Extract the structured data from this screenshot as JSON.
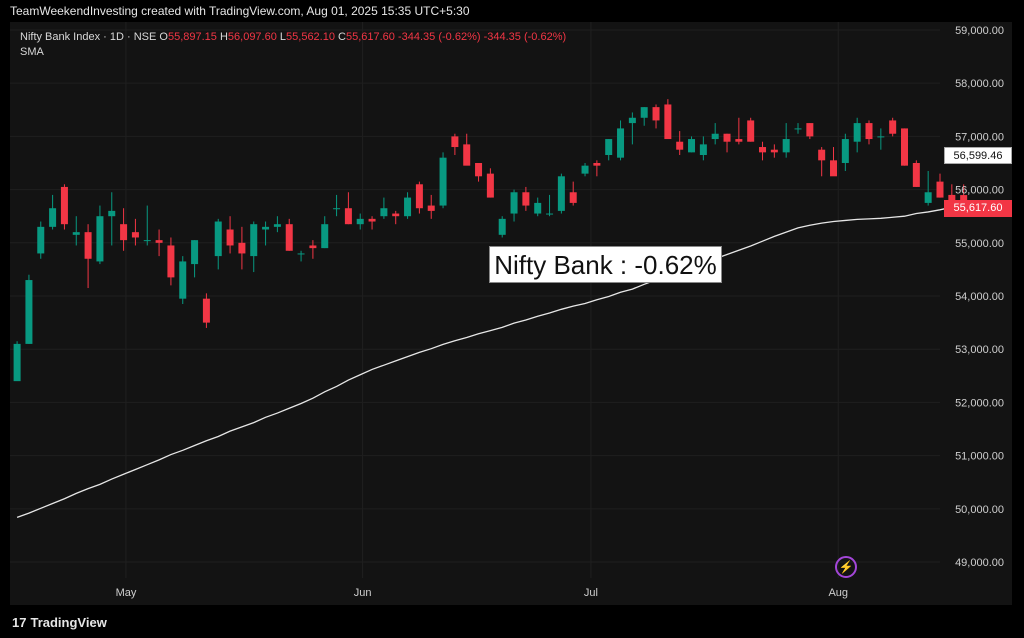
{
  "header": {
    "attribution": "TeamWeekendInvesting created with TradingView.com, Aug 01, 2025 15:35 UTC+5:30"
  },
  "legend": {
    "symbol": "Nifty Bank Index · 1D · NSE",
    "open_label": "O",
    "open": "55,897.15",
    "high_label": "H",
    "high": "56,097.60",
    "low_label": "L",
    "low": "55,562.10",
    "close_label": "C",
    "close": "55,617.60",
    "change": "-344.35 (-0.62%)",
    "change2": "-344.35 (-0.62%)",
    "indicator": "SMA"
  },
  "annotation": "Nifty Bank : -0.62%",
  "price_tags": {
    "sma": "56,599.46",
    "last": "55,617.60"
  },
  "footer": {
    "brand": "TradingView",
    "logo": "17"
  },
  "colors": {
    "up": "#089981",
    "down": "#f23645",
    "sma": "#e6e6e6",
    "bg": "#131313"
  },
  "icons": {
    "bolt": "lightning-icon"
  },
  "chart_data": {
    "type": "candlestick",
    "ylim": [
      48700,
      59150
    ],
    "y_ticks": [
      "49,000.00",
      "50,000.00",
      "51,000.00",
      "52,000.00",
      "53,000.00",
      "54,000.00",
      "55,000.00",
      "56,000.00",
      "57,000.00",
      "58,000.00",
      "59,000.00"
    ],
    "y_tick_values": [
      49000,
      50000,
      51000,
      52000,
      53000,
      54000,
      55000,
      56000,
      57000,
      58000,
      59000
    ],
    "x_labels": [
      {
        "label": "May",
        "index": 9.2
      },
      {
        "label": "Jun",
        "index": 29.2
      },
      {
        "label": "Jul",
        "index": 48.5
      },
      {
        "label": "Aug",
        "index": 69.4
      }
    ],
    "index_range": [
      -0.6,
      78
    ],
    "candles": [
      [
        52400,
        53150,
        52450,
        53100
      ],
      [
        53100,
        54400,
        53100,
        54300
      ],
      [
        54800,
        55400,
        54700,
        55300
      ],
      [
        55300,
        55900,
        55250,
        55650
      ],
      [
        56050,
        56100,
        55250,
        55350
      ],
      [
        55150,
        55500,
        54950,
        55200
      ],
      [
        55200,
        55350,
        54150,
        54700
      ],
      [
        54650,
        55700,
        54600,
        55500
      ],
      [
        55500,
        55950,
        54950,
        55600
      ],
      [
        55350,
        55650,
        54850,
        55050
      ],
      [
        55200,
        55450,
        54950,
        55100
      ],
      [
        55050,
        55700,
        54950,
        55050
      ],
      [
        55050,
        55250,
        54750,
        55000
      ],
      [
        54950,
        55100,
        54200,
        54350
      ],
      [
        53950,
        54750,
        53850,
        54650
      ],
      [
        54600,
        55050,
        54350,
        55050
      ],
      [
        53950,
        54050,
        53400,
        53500
      ],
      [
        54750,
        55450,
        54500,
        55400
      ],
      [
        55250,
        55500,
        54800,
        54950
      ],
      [
        55000,
        55300,
        54500,
        54800
      ],
      [
        54750,
        55400,
        54450,
        55350
      ],
      [
        55250,
        55400,
        54950,
        55300
      ],
      [
        55300,
        55500,
        55200,
        55350
      ],
      [
        55350,
        55450,
        54850,
        54850
      ],
      [
        54800,
        54850,
        54650,
        54800
      ],
      [
        54950,
        55050,
        54700,
        54900
      ],
      [
        54900,
        55500,
        54900,
        55350
      ],
      [
        55650,
        55900,
        55500,
        55650
      ],
      [
        55650,
        55950,
        55350,
        55350
      ],
      [
        55350,
        55550,
        55250,
        55450
      ],
      [
        55450,
        55500,
        55250,
        55400
      ],
      [
        55500,
        55850,
        55450,
        55650
      ],
      [
        55550,
        55600,
        55350,
        55500
      ],
      [
        55500,
        55950,
        55450,
        55850
      ],
      [
        56100,
        56150,
        55550,
        55650
      ],
      [
        55700,
        55900,
        55450,
        55600
      ],
      [
        55700,
        56700,
        55650,
        56600
      ],
      [
        57000,
        57050,
        56650,
        56800
      ],
      [
        56850,
        57050,
        56500,
        56450
      ],
      [
        56500,
        56450,
        56150,
        56250
      ],
      [
        56300,
        56400,
        55850,
        55850
      ],
      [
        55150,
        55500,
        55100,
        55450
      ],
      [
        55550,
        56000,
        55400,
        55950
      ],
      [
        55950,
        56050,
        55600,
        55700
      ],
      [
        55550,
        55850,
        55500,
        55750
      ],
      [
        55550,
        55900,
        55500,
        55550
      ],
      [
        55600,
        56300,
        55550,
        56250
      ],
      [
        55950,
        56150,
        55700,
        55750
      ],
      [
        56300,
        56500,
        56250,
        56450
      ],
      [
        56500,
        56550,
        56250,
        56450
      ],
      [
        56650,
        56950,
        56550,
        56950
      ],
      [
        56600,
        57300,
        56550,
        57150
      ],
      [
        57250,
        57450,
        56850,
        57350
      ],
      [
        57350,
        57550,
        57200,
        57550
      ],
      [
        57550,
        57600,
        57150,
        57300
      ],
      [
        57600,
        57700,
        57050,
        56950
      ],
      [
        56900,
        57100,
        56650,
        56750
      ],
      [
        56700,
        57000,
        56700,
        56950
      ],
      [
        56650,
        57000,
        56550,
        56850
      ],
      [
        56950,
        57250,
        56850,
        57050
      ],
      [
        57050,
        57050,
        56700,
        56900
      ],
      [
        56950,
        57350,
        56850,
        56900
      ],
      [
        57300,
        57350,
        56900,
        56900
      ],
      [
        56800,
        56900,
        56550,
        56700
      ],
      [
        56750,
        56850,
        56600,
        56700
      ],
      [
        56700,
        57250,
        56600,
        56950
      ],
      [
        57150,
        57250,
        57050,
        57150
      ],
      [
        57250,
        57250,
        56950,
        57000
      ],
      [
        56750,
        56800,
        56250,
        56550
      ],
      [
        56550,
        56800,
        56350,
        56250
      ],
      [
        56500,
        57050,
        56350,
        56950
      ],
      [
        56900,
        57350,
        56700,
        57250
      ],
      [
        57250,
        57300,
        56850,
        56950
      ],
      [
        57000,
        57150,
        56750,
        57000
      ],
      [
        57300,
        57350,
        57000,
        57050
      ],
      [
        57150,
        57150,
        56450,
        56450
      ],
      [
        56500,
        56550,
        56050,
        56050
      ],
      [
        55750,
        56350,
        55700,
        55950
      ],
      [
        56150,
        56300,
        55850,
        55850
      ],
      [
        55900,
        56100,
        55500,
        55600
      ],
      [
        55897.15,
        56097.6,
        55562.1,
        55617.6
      ]
    ],
    "sma": [
      49840,
      49920,
      50010,
      50100,
      50190,
      50290,
      50380,
      50460,
      50560,
      50650,
      50740,
      50830,
      50920,
      51020,
      51100,
      51190,
      51280,
      51360,
      51460,
      51540,
      51620,
      51720,
      51800,
      51890,
      51980,
      52080,
      52200,
      52300,
      52420,
      52520,
      52620,
      52700,
      52780,
      52860,
      52940,
      53010,
      53090,
      53160,
      53220,
      53290,
      53350,
      53410,
      53490,
      53550,
      53620,
      53680,
      53750,
      53810,
      53860,
      53930,
      53990,
      54070,
      54130,
      54220,
      54300,
      54380,
      54450,
      54530,
      54620,
      54700,
      54780,
      54860,
      54940,
      55030,
      55120,
      55200,
      55280,
      55330,
      55370,
      55400,
      55420,
      55440,
      55450,
      55460,
      55480,
      55500,
      55550,
      55580,
      55620,
      55670,
      55720
    ]
  }
}
